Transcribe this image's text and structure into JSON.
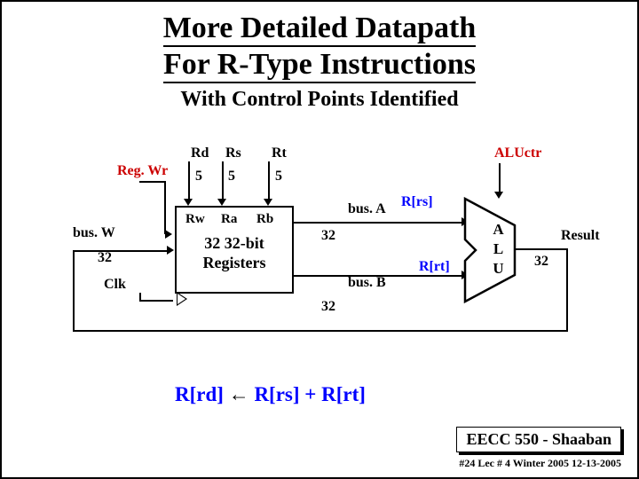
{
  "title_line1": "More Detailed Datapath",
  "title_line2": "For R-Type Instructions",
  "subtitle": "With Control Points Identified",
  "labels": {
    "rd": "Rd",
    "rs": "Rs",
    "rt": "Rt",
    "regwr": "Reg. Wr",
    "five_a": "5",
    "five_b": "5",
    "five_c": "5",
    "rw": "Rw",
    "ra": "Ra",
    "rb": "Rb",
    "regfile_l1": "32 32-bit",
    "regfile_l2": "Registers",
    "busw": "bus. W",
    "thirtytwo_w": "32",
    "clk": "Clk",
    "busa": "bus. A",
    "thirtytwo_a": "32",
    "busb": "bus. B",
    "thirtytwo_b": "32",
    "aluctr": "ALUctr",
    "r_rs": "R[rs]",
    "r_rt": "R[rt]",
    "alu": "ALU",
    "result": "Result",
    "thirtytwo_r": "32"
  },
  "equation": {
    "lhs": "R[rd]",
    "arrow": "←",
    "rhs": "R[rs]  +  R[rt]"
  },
  "footer": {
    "course": "EECC 550 - Shaaban",
    "pageinfo": "#24   Lec # 4   Winter 2005   12-13-2005"
  }
}
